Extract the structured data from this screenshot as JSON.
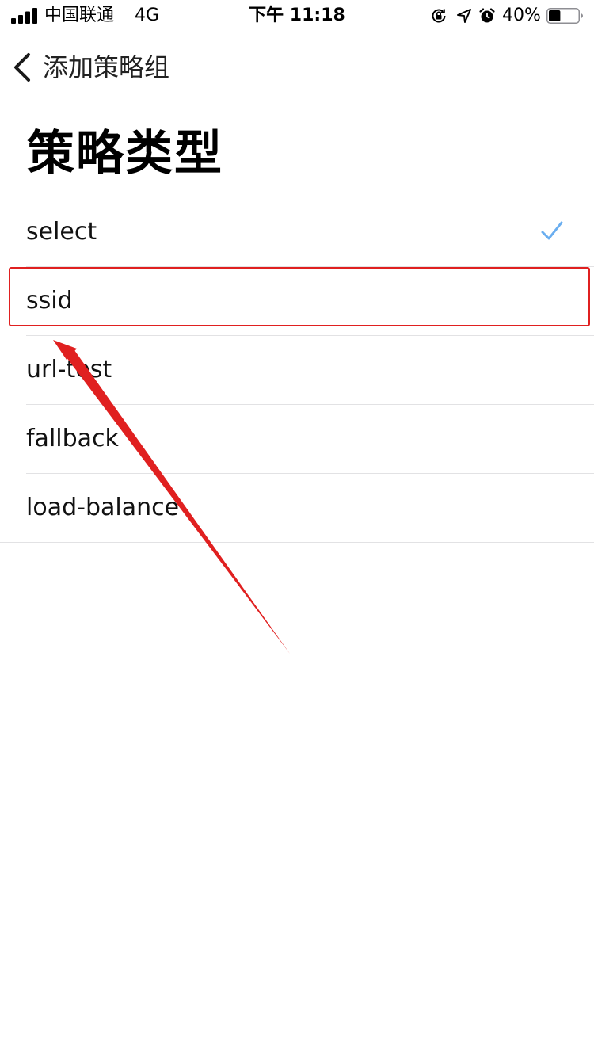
{
  "status_bar": {
    "carrier": "中国联通",
    "network": "4G",
    "time": "下午 11:18",
    "battery_percent_text": "40%",
    "battery_level": 0.4,
    "icons": [
      "signal-icon",
      "orientation-lock-icon",
      "location-icon",
      "alarm-icon",
      "battery-icon"
    ]
  },
  "navbar": {
    "back_label": "添加策略组",
    "back_icon": "chevron-left-icon"
  },
  "section": {
    "title": "策略类型"
  },
  "options": [
    {
      "label": "select",
      "selected": true
    },
    {
      "label": "ssid",
      "selected": false
    },
    {
      "label": "url-test",
      "selected": false
    },
    {
      "label": "fallback",
      "selected": false
    },
    {
      "label": "load-balance",
      "selected": false
    }
  ],
  "colors": {
    "accent_check": "#6aaef0",
    "annotation_red": "#e02020",
    "separator": "#e2e2e4"
  }
}
